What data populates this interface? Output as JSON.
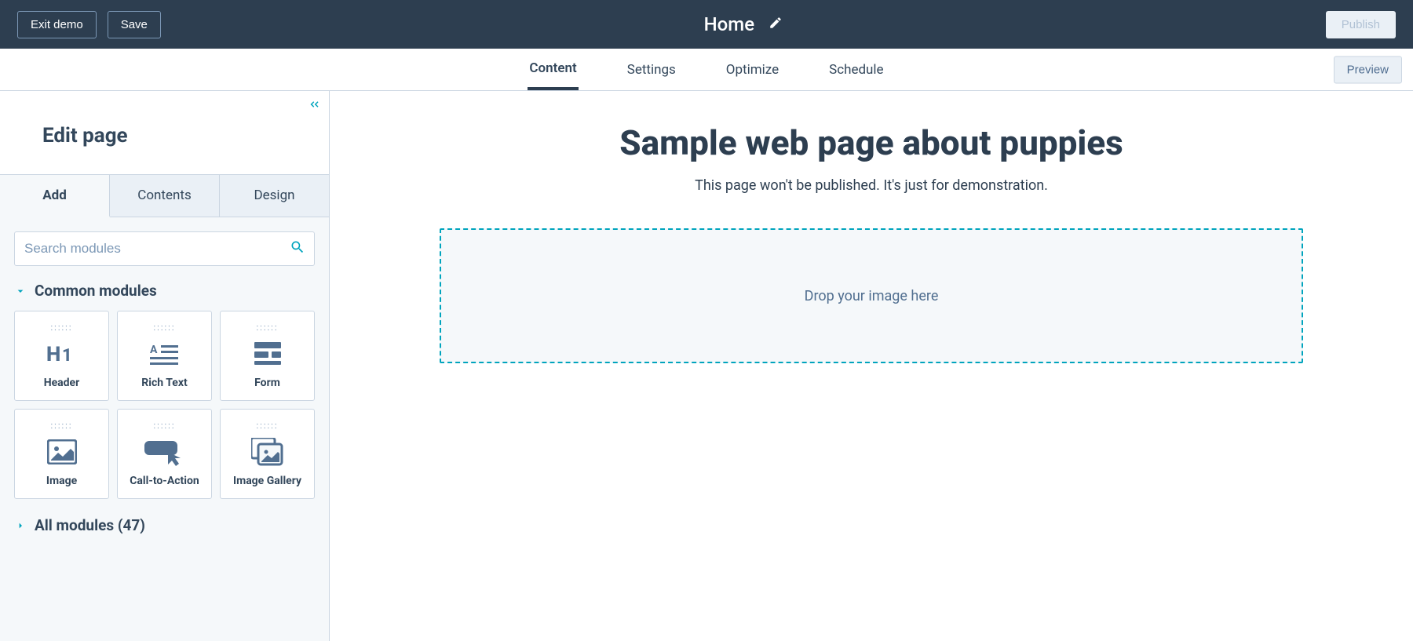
{
  "topbar": {
    "exit_label": "Exit demo",
    "save_label": "Save",
    "page_name": "Home",
    "publish_label": "Publish"
  },
  "navtabs": {
    "items": [
      {
        "label": "Content",
        "active": true
      },
      {
        "label": "Settings",
        "active": false
      },
      {
        "label": "Optimize",
        "active": false
      },
      {
        "label": "Schedule",
        "active": false
      }
    ],
    "preview_label": "Preview"
  },
  "sidebar": {
    "title": "Edit page",
    "tabs": [
      {
        "label": "Add",
        "active": true
      },
      {
        "label": "Contents",
        "active": false
      },
      {
        "label": "Design",
        "active": false
      }
    ],
    "search_placeholder": "Search modules",
    "sections": {
      "common": {
        "title": "Common modules",
        "expanded": true,
        "modules": [
          {
            "label": "Header"
          },
          {
            "label": "Rich Text"
          },
          {
            "label": "Form"
          },
          {
            "label": "Image"
          },
          {
            "label": "Call-to-Action"
          },
          {
            "label": "Image Gallery"
          }
        ]
      },
      "all": {
        "title": "All modules (47)",
        "expanded": false
      }
    }
  },
  "canvas": {
    "title": "Sample web page about puppies",
    "subtitle": "This page won't be published. It's just for demonstration.",
    "dropzone_text": "Drop your image here"
  }
}
